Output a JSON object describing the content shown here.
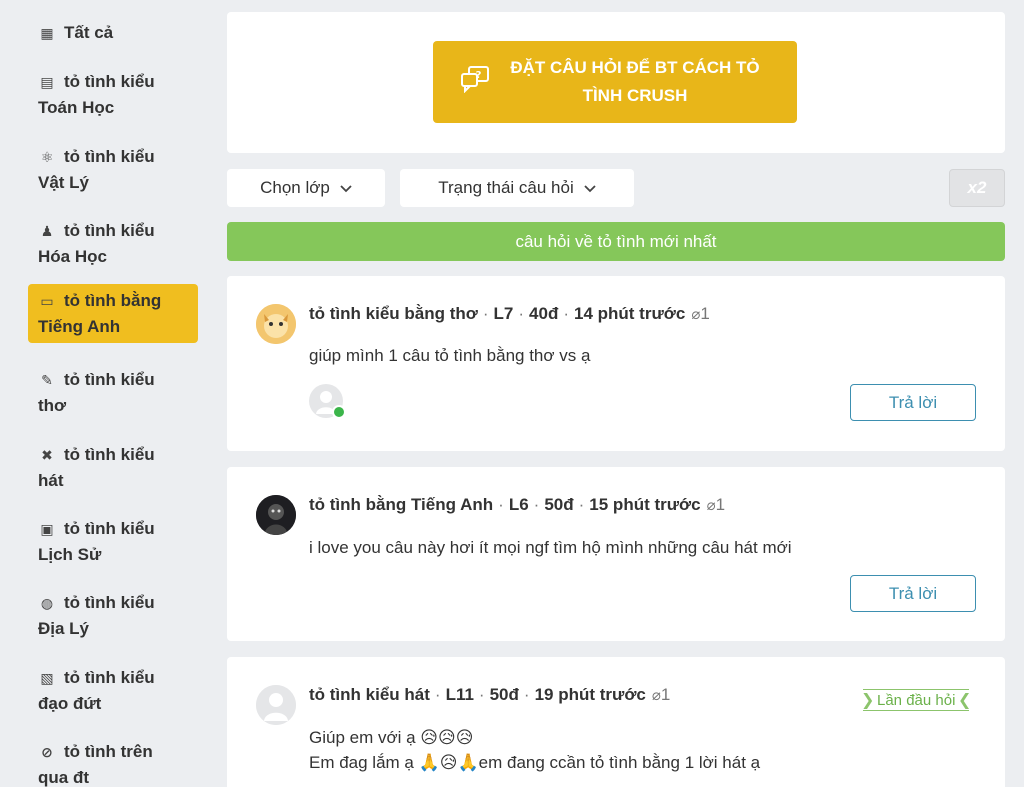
{
  "sidebar": {
    "items": [
      {
        "icon": "grid-icon",
        "glyph": "▦",
        "label": "Tất cả"
      },
      {
        "icon": "math-icon",
        "glyph": "▤",
        "line1": "tỏ tình kiểu",
        "line2": "Toán Học"
      },
      {
        "icon": "atom-icon",
        "glyph": "⚛",
        "line1": "tỏ tình kiểu",
        "line2": "Vật Lý"
      },
      {
        "icon": "flask-icon",
        "glyph": "♟",
        "line1": "tỏ tình kiểu",
        "line2": "Hóa Học"
      },
      {
        "icon": "english-icon",
        "glyph": "▭",
        "line1": "tỏ tình bằng",
        "line2": "Tiếng Anh"
      },
      {
        "icon": "book-pen-icon",
        "glyph": "✎",
        "line1": "tỏ tình kiểu",
        "line2": "thơ"
      },
      {
        "icon": "music-icon",
        "glyph": "✖",
        "line1": "tỏ tình kiểu",
        "line2": "hát"
      },
      {
        "icon": "history-icon",
        "glyph": "▣",
        "line1": "tỏ tình kiểu",
        "line2": "Lịch Sử"
      },
      {
        "icon": "globe-icon",
        "glyph": "◍",
        "line1": "tỏ tình kiểu",
        "line2": "Địa Lý"
      },
      {
        "icon": "ethics-icon",
        "glyph": "▧",
        "line1": "tỏ tình kiểu",
        "line2": "đạo đứt"
      },
      {
        "icon": "phone-icon",
        "glyph": "⊘",
        "line1": "tỏ tình trên",
        "line2": "qua đt"
      }
    ]
  },
  "ask": {
    "line1": "ĐẶT CÂU HỎI ĐỂ BT CÁCH TỎ",
    "line2": "TÌNH CRUSH"
  },
  "filters": {
    "class_label": "Chọn lớp",
    "status_label": "Trạng thái câu hỏi",
    "x2_label": "x2"
  },
  "banner": "câu hỏi về tỏ tình mới nhất",
  "questions": [
    {
      "subject": "tỏ tình kiểu bằng thơ",
      "grade": "L7",
      "points": "40đ",
      "time": "14 phút trước",
      "attach": "1",
      "text": "giúp mình 1 câu tỏ tình bằng thơ vs ạ",
      "reply": "Trả lời"
    },
    {
      "subject": "tỏ tình bằng Tiếng Anh",
      "grade": "L6",
      "points": "50đ",
      "time": "15 phút trước",
      "attach": "1",
      "text": "i love you câu này hơi ít mọi ngf tìm hộ mình những câu hát mới",
      "reply": "Trả lời"
    },
    {
      "subject": "tỏ tình kiểu hát",
      "grade": "L11",
      "points": "50đ",
      "time": "19 phút trước",
      "attach": "1",
      "text1": "Giúp em với ạ 😥😥😥",
      "text2": "Em đag lắm ạ 🙏😥🙏em đang ccần tỏ tình bằng 1 lời hát ạ",
      "badge": "Lần đầu hỏi"
    }
  ],
  "colors": {
    "accent": "#f0be1f",
    "ask_button": "#e8b619",
    "banner": "#85c75a",
    "reply": "#3d8fb0"
  }
}
